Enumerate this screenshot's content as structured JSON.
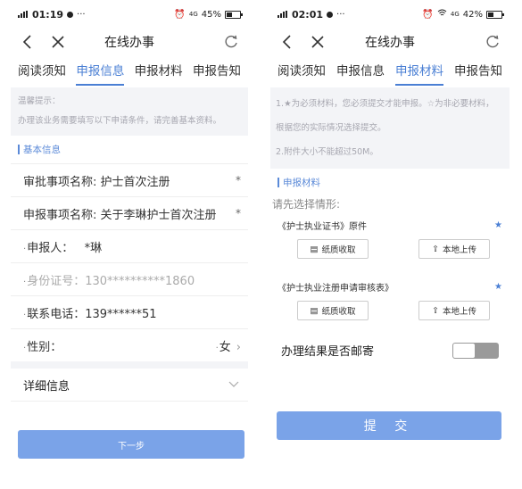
{
  "left": {
    "status": {
      "time": "01:19",
      "battery": "45%",
      "net": "4G"
    },
    "title": "在线办事",
    "tabs": [
      "阅读须知",
      "申报信息",
      "申报材料",
      "申报告知"
    ],
    "active_tab": 1,
    "notice_heading": "温馨提示：",
    "notice_text": "办理该业务需要填写以下申请条件，请完善基本资料。",
    "section": "基本信息",
    "fields": [
      {
        "label": "审批事项名称:",
        "value": "护士首次注册",
        "req": "*"
      },
      {
        "label": "申报事项名称:",
        "value": "关于李琳护士首次注册",
        "req": "*"
      }
    ],
    "applicant_label": "申报人：",
    "applicant_value": "*琳",
    "id_label": "身份证号：",
    "id_value": "130**********1860",
    "phone_label": "联系电话：",
    "phone_value": "139******51",
    "gender_label": "性别：",
    "gender_value": "女",
    "detail_label": "详细信息",
    "next_button": "下一步"
  },
  "right": {
    "status": {
      "time": "02:01",
      "battery": "42%",
      "net": "4G"
    },
    "title": "在线办事",
    "tabs": [
      "阅读须知",
      "申报信息",
      "申报材料",
      "申报告知"
    ],
    "active_tab": 2,
    "notice_line1": "1.★为必须材料，您必须提交才能申报。☆为非必要材料，",
    "notice_line2": "根据您的实际情况选择提交。",
    "notice_line3": "2.附件大小不能超过50M。",
    "section": "申报材料",
    "prompt": "请先选择情形:",
    "materials": [
      {
        "name": "《护士执业证书》原件",
        "star": "★",
        "paper": "纸质收取",
        "upload": "本地上传"
      },
      {
        "name": "《护士执业注册申请审核表》",
        "star": "★",
        "paper": "纸质收取",
        "upload": "本地上传"
      }
    ],
    "mail_label": "办理结果是否邮寄",
    "mail_toggle": false,
    "submit_button": "提 交"
  },
  "colors": {
    "accent": "#4a7fd4",
    "button": "#7aa3e8"
  },
  "icons": [
    "back-icon",
    "close-icon",
    "refresh-icon",
    "chevron-right-icon",
    "chevron-down-icon",
    "paper-icon",
    "upload-icon",
    "signal-icon",
    "battery-icon",
    "wifi-icon",
    "alarm-icon"
  ]
}
